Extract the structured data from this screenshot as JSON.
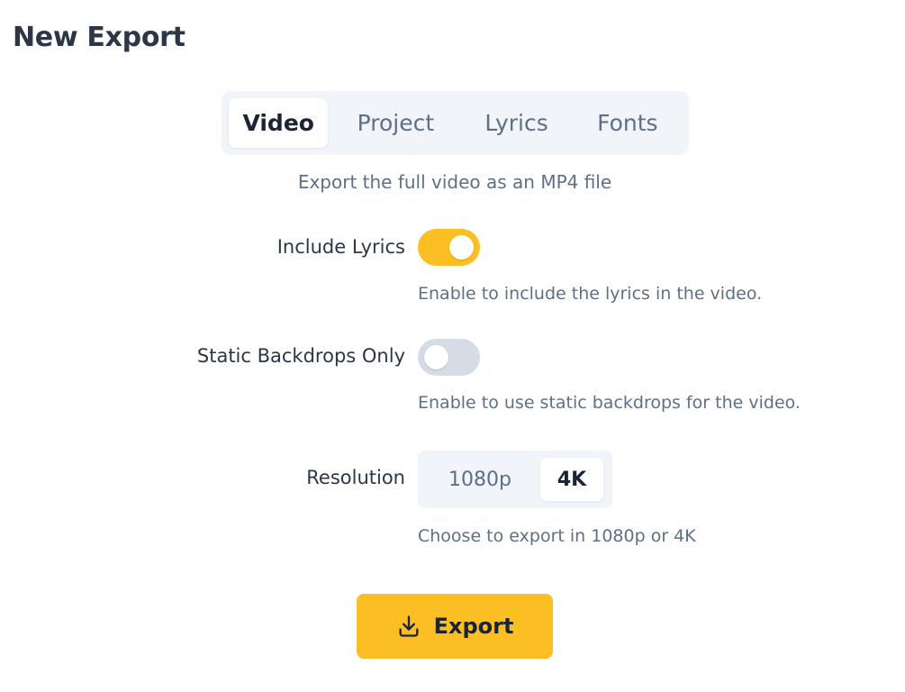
{
  "page_title": "New Export",
  "tabs": [
    {
      "label": "Video",
      "active": true
    },
    {
      "label": "Project",
      "active": false
    },
    {
      "label": "Lyrics",
      "active": false
    },
    {
      "label": "Fonts",
      "active": false
    }
  ],
  "subtitle": "Export the full video as an MP4 file",
  "settings": {
    "include_lyrics": {
      "label": "Include Lyrics",
      "enabled": true,
      "help": "Enable to include the lyrics in the video."
    },
    "static_backdrops": {
      "label": "Static Backdrops Only",
      "enabled": false,
      "help": "Enable to use static backdrops for the video."
    },
    "resolution": {
      "label": "Resolution",
      "options": [
        "1080p",
        "4K"
      ],
      "selected": "4K",
      "help": "Choose to export in 1080p or 4K"
    }
  },
  "export_button": {
    "label": "Export",
    "icon": "download-icon"
  },
  "colors": {
    "accent": "#fbbf24",
    "toggle_off": "#d5dce6",
    "muted_text": "#5f6f86",
    "panel_bg": "#f1f4f9"
  }
}
